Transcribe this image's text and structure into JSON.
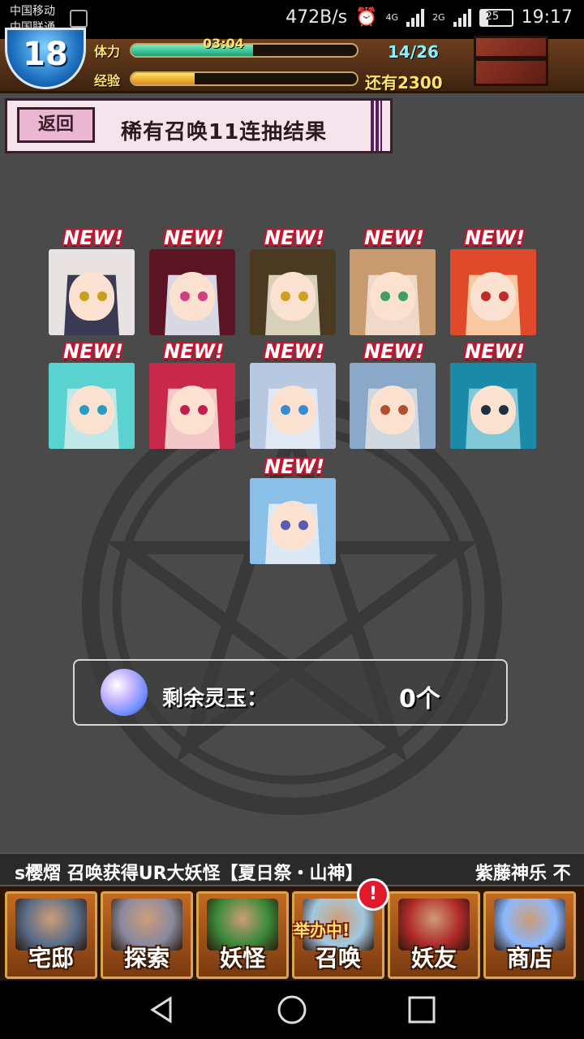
{
  "status_bar": {
    "carrier_1": "中国移动",
    "carrier_2": "中国联通",
    "net_speed": "472B/s",
    "net_4g": "4G",
    "net_2g": "2G",
    "battery": "25",
    "time": "19:17"
  },
  "topbar": {
    "level": "18",
    "stamina_label": "体力",
    "stamina_timer": "03:04",
    "stamina_count": "14/26",
    "stamina_fraction": 0.54,
    "exp_label": "经验",
    "exp_remaining": "还有2300",
    "exp_fraction": 0.28
  },
  "header": {
    "back_label": "返回",
    "title": "稀有召唤11连抽结果"
  },
  "results": {
    "new_label": "NEW!",
    "cards": [
      {
        "name": "card-1",
        "hair": "#e8e2e2",
        "bg": "#3a3a55",
        "eye": "#c8a020"
      },
      {
        "name": "card-2",
        "hair": "#5a1424",
        "bg": "#d8d8e4",
        "eye": "#d04080"
      },
      {
        "name": "card-3",
        "hair": "#4a3a20",
        "bg": "#d8d0b8",
        "eye": "#d0a020"
      },
      {
        "name": "card-4",
        "hair": "#c89a70",
        "bg": "#f0d8c8",
        "eye": "#40a060"
      },
      {
        "name": "card-5",
        "hair": "#e04a2a",
        "bg": "#f8c8a0",
        "eye": "#c02a2a"
      },
      {
        "name": "card-6",
        "hair": "#5ad2d0",
        "bg": "#c0e8e8",
        "eye": "#2a9ac0"
      },
      {
        "name": "card-7",
        "hair": "#c8284a",
        "bg": "#f4c8c8",
        "eye": "#c02050"
      },
      {
        "name": "card-8",
        "hair": "#b8c8e0",
        "bg": "#e0e8f4",
        "eye": "#3a8ad0"
      },
      {
        "name": "card-9",
        "hair": "#8aa8c8",
        "bg": "#d0d8e0",
        "eye": "#b05030"
      },
      {
        "name": "card-10",
        "hair": "#1a8aa8",
        "bg": "#80c8d8",
        "eye": "#203040"
      },
      {
        "name": "card-11",
        "hair": "#8ac0e8",
        "bg": "#dce8f4",
        "eye": "#5a5ab0"
      }
    ]
  },
  "summary": {
    "label": "剩余灵玉：",
    "value": "0个"
  },
  "ticker": {
    "text_1": "s樱熠  召唤获得UR大妖怪【夏日祭・山神】",
    "text_2": "紫藤神乐  不"
  },
  "nav": {
    "items": [
      {
        "label": "宅邸",
        "icon": "mansion-icon",
        "color": "#5a6e8a"
      },
      {
        "label": "探索",
        "icon": "magnifier-icon",
        "color": "#8a8aa0"
      },
      {
        "label": "妖怪",
        "icon": "scroll-icon",
        "color": "#3a8a3a"
      },
      {
        "label": "召唤",
        "icon": "summon-icon",
        "color": "#a0c8e0"
      },
      {
        "label": "妖友",
        "icon": "friend-icon",
        "color": "#b02a2a"
      },
      {
        "label": "商店",
        "icon": "orb-icon",
        "color": "#8ab8ff"
      }
    ],
    "summon_badge": "!",
    "summon_event": "举办中!"
  }
}
